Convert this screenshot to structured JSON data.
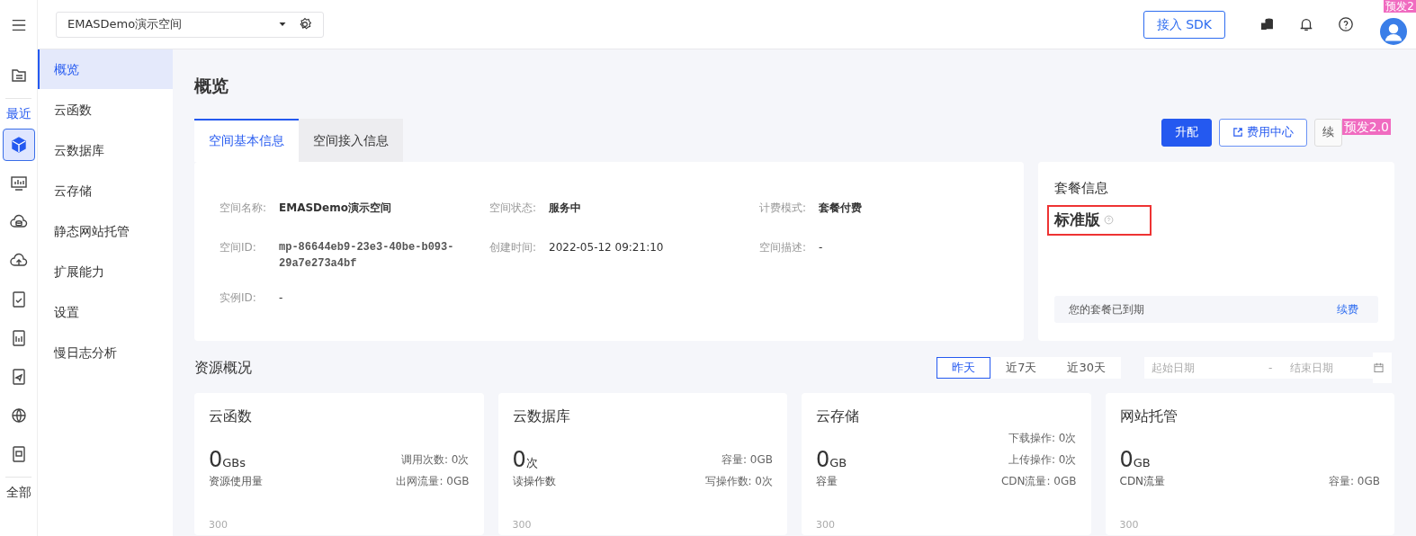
{
  "rail": {
    "items": [
      {
        "kind": "icon",
        "selected": false
      },
      {
        "kind": "divider"
      },
      {
        "kind": "label",
        "text": "最近",
        "selected": true
      },
      {
        "kind": "icon",
        "selected": true
      },
      {
        "kind": "icon",
        "selected": false
      },
      {
        "kind": "icon",
        "selected": false
      },
      {
        "kind": "icon",
        "selected": false
      },
      {
        "kind": "icon",
        "selected": false
      },
      {
        "kind": "icon",
        "selected": false
      },
      {
        "kind": "icon",
        "selected": false
      },
      {
        "kind": "icon",
        "selected": false
      },
      {
        "kind": "icon",
        "selected": false
      },
      {
        "kind": "divider"
      },
      {
        "kind": "label",
        "text": "全部",
        "selected": false
      }
    ]
  },
  "header": {
    "workspace": "EMASDemo演示空间",
    "sdk_button": "接入 SDK",
    "env_badge": "预发2"
  },
  "sidebar": {
    "items": [
      {
        "label": "概览",
        "selected": true
      },
      {
        "label": "云函数",
        "selected": false
      },
      {
        "label": "云数据库",
        "selected": false
      },
      {
        "label": "云存储",
        "selected": false
      },
      {
        "label": "静态网站托管",
        "selected": false
      },
      {
        "label": "扩展能力",
        "selected": false
      },
      {
        "label": "设置",
        "selected": false
      },
      {
        "label": "慢日志分析",
        "selected": false
      }
    ]
  },
  "page_title": "概览",
  "tabs": [
    {
      "label": "空间基本信息",
      "selected": true
    },
    {
      "label": "空间接入信息",
      "selected": false
    }
  ],
  "actions": [
    {
      "kind": "primary",
      "label": "升配"
    },
    {
      "kind": "outline",
      "label": "费用中心"
    },
    {
      "kind": "light",
      "label": "续"
    }
  ],
  "action_badge": "预发2.0",
  "info_fields": [
    {
      "label": "空间名称:",
      "value": "EMASDemo演示空间",
      "kind": "bold"
    },
    {
      "label": "空间状态:",
      "value": "服务中",
      "kind": "bold"
    },
    {
      "label": "计费模式:",
      "value": "套餐付费",
      "kind": "bold"
    },
    {
      "label": "空间ID:",
      "value": "mp-86644eb9-23e3-40be-b093-29a7e273a4bf",
      "kind": "mono"
    },
    {
      "label": "创建时间:",
      "value": "2022-05-12 09:21:10",
      "kind": "plain"
    },
    {
      "label": "空间描述:",
      "value": "-",
      "kind": "plain"
    },
    {
      "label": "实例ID:",
      "value": "-",
      "kind": "plain"
    }
  ],
  "plan": {
    "title": "套餐信息",
    "name": "标准版",
    "highlighted": true,
    "notice": "您的套餐已到期",
    "renew_link": "续费"
  },
  "resources": {
    "title": "资源概况",
    "ranges": [
      {
        "label": "昨天",
        "selected": true
      },
      {
        "label": "近7天",
        "selected": false
      },
      {
        "label": "近30天",
        "selected": false
      }
    ],
    "start_placeholder": "起始日期",
    "separator": "-",
    "end_placeholder": "结束日期",
    "cards": [
      {
        "title": "云函数",
        "value": "0",
        "unit": "GBs",
        "label": "资源使用量",
        "stats": [
          "调用次数: 0次",
          "出网流量: 0GB"
        ],
        "axis_label": "300"
      },
      {
        "title": "云数据库",
        "value": "0",
        "unit": "次",
        "label": "读操作数",
        "stats": [
          "容量: 0GB",
          "写操作数: 0次"
        ],
        "axis_label": "300"
      },
      {
        "title": "云存储",
        "value": "0",
        "unit": "GB",
        "label": "容量",
        "stats": [
          "下载操作: 0次",
          "上传操作: 0次",
          "CDN流量: 0GB"
        ],
        "axis_label": "300"
      },
      {
        "title": "网站托管",
        "value": "0",
        "unit": "GB",
        "label": "CDN流量",
        "stats": [
          "容量: 0GB"
        ],
        "axis_label": "300"
      }
    ]
  }
}
